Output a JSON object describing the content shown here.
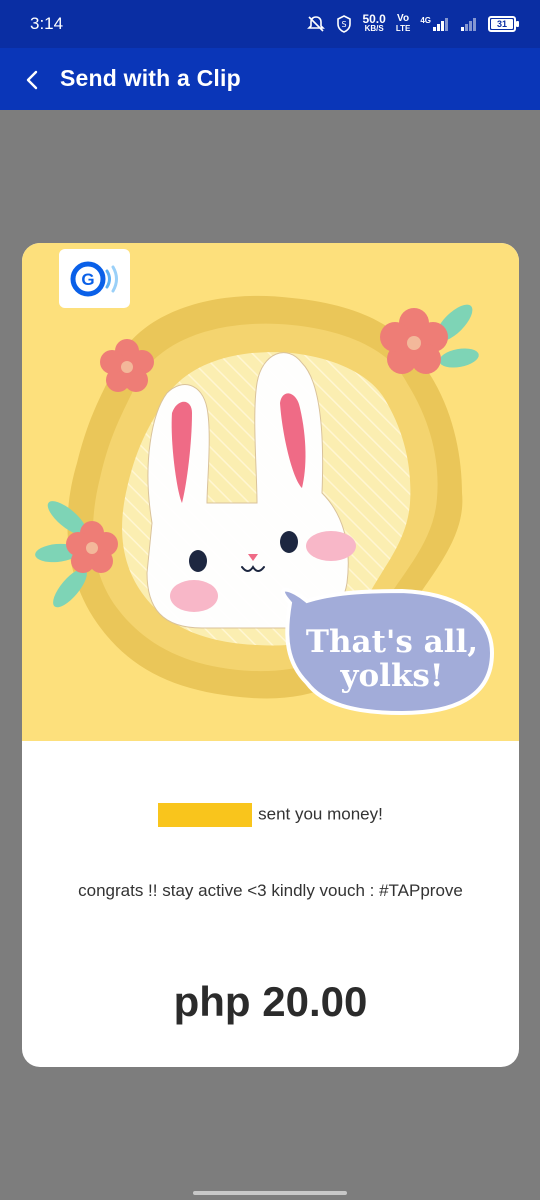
{
  "status_bar": {
    "time": "3:14",
    "net_speed_value": "50.0",
    "net_speed_unit": "KB/S",
    "volte_top": "Vo",
    "volte_bottom": "LTE",
    "network": "4G",
    "battery": "31"
  },
  "app_bar": {
    "title": "Send with a Clip",
    "back_icon": "back-chevron-icon"
  },
  "clip": {
    "speech_line1": "That's all,",
    "speech_line2": "yolks!",
    "logo_icon": "gcash-logo-icon",
    "bg_color": "#fde07c"
  },
  "card": {
    "sender_text": "sent you money!",
    "message": "congrats !! stay active <3 kindly vouch : #TAPprove",
    "amount": "php 20.00"
  },
  "colors": {
    "app_bar": "#0a36b8",
    "status_bar": "#0a2ea3",
    "background": "#7d7d7d",
    "redaction": "#f9c51c"
  }
}
